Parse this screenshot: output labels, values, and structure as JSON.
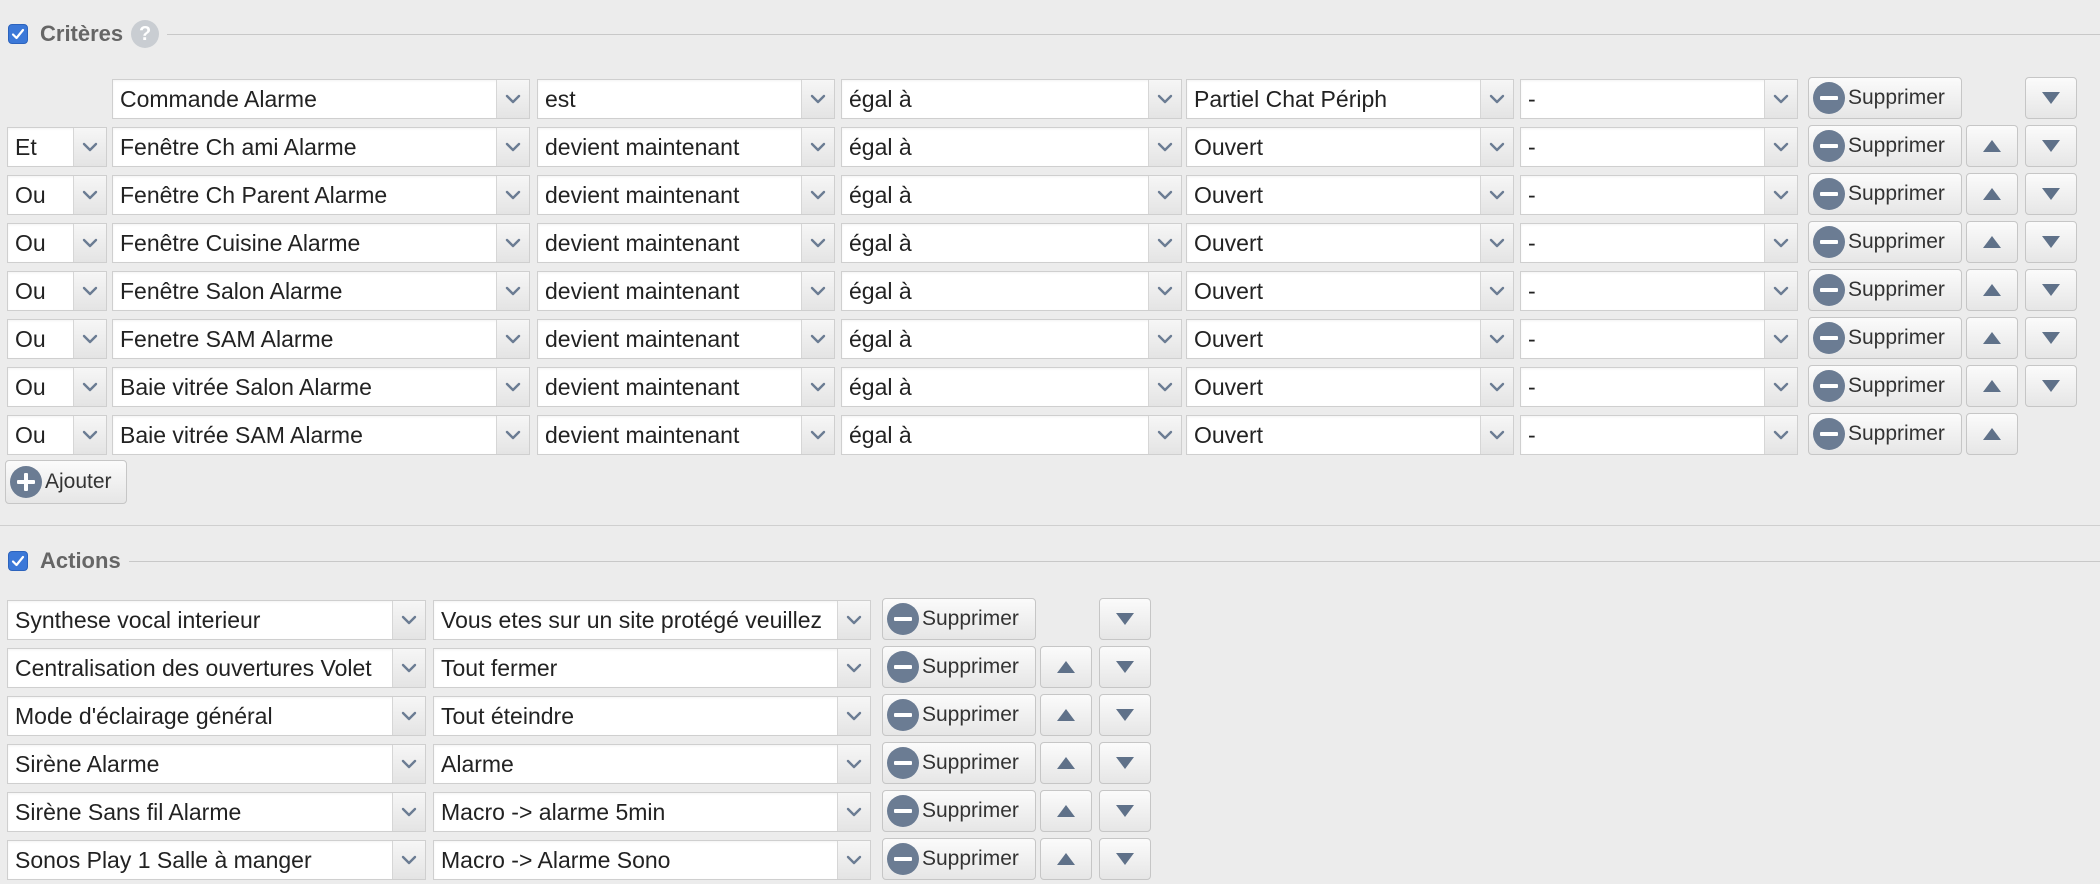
{
  "criteria": {
    "title": "Critères",
    "help_icon": "question-mark-icon",
    "help_text": "?",
    "delete_label": "Supprimer",
    "add_label": "Ajouter",
    "rows": [
      {
        "logic": "",
        "device": "Commande Alarme",
        "verb": "est",
        "operator": "égal à",
        "value": "Partiel Chat Périph",
        "extra": "-",
        "up": false,
        "down": true
      },
      {
        "logic": "Et",
        "device": "Fenêtre Ch ami Alarme",
        "verb": "devient maintenant",
        "operator": "égal à",
        "value": "Ouvert",
        "extra": "-",
        "up": true,
        "down": true
      },
      {
        "logic": "Ou",
        "device": "Fenêtre Ch Parent Alarme",
        "verb": "devient maintenant",
        "operator": "égal à",
        "value": "Ouvert",
        "extra": "-",
        "up": true,
        "down": true
      },
      {
        "logic": "Ou",
        "device": "Fenêtre Cuisine Alarme",
        "verb": "devient maintenant",
        "operator": "égal à",
        "value": "Ouvert",
        "extra": "-",
        "up": true,
        "down": true
      },
      {
        "logic": "Ou",
        "device": "Fenêtre Salon Alarme",
        "verb": "devient maintenant",
        "operator": "égal à",
        "value": "Ouvert",
        "extra": "-",
        "up": true,
        "down": true
      },
      {
        "logic": "Ou",
        "device": "Fenetre SAM Alarme",
        "verb": "devient maintenant",
        "operator": "égal à",
        "value": "Ouvert",
        "extra": "-",
        "up": true,
        "down": true
      },
      {
        "logic": "Ou",
        "device": "Baie vitrée Salon Alarme",
        "verb": "devient maintenant",
        "operator": "égal à",
        "value": "Ouvert",
        "extra": "-",
        "up": true,
        "down": true
      },
      {
        "logic": "Ou",
        "device": "Baie vitrée SAM Alarme",
        "verb": "devient maintenant",
        "operator": "égal à",
        "value": "Ouvert",
        "extra": "-",
        "up": true,
        "down": false
      }
    ]
  },
  "actions": {
    "title": "Actions",
    "delete_label": "Supprimer",
    "rows": [
      {
        "device": "Synthese vocal interieur",
        "command": "Vous etes sur un site protégé veuillez",
        "up": false,
        "down": true
      },
      {
        "device": "Centralisation des ouvertures Volet",
        "command": "Tout fermer",
        "up": true,
        "down": true
      },
      {
        "device": "Mode d'éclairage général",
        "command": "Tout éteindre",
        "up": true,
        "down": true
      },
      {
        "device": "Sirène Alarme",
        "command": "Alarme",
        "up": true,
        "down": true
      },
      {
        "device": "Sirène Sans fil Alarme",
        "command": "Macro -> alarme 5min",
        "up": true,
        "down": true
      },
      {
        "device": "Sonos Play 1 Salle à manger",
        "command": "Macro -> Alarme Sono",
        "up": true,
        "down": true
      }
    ]
  },
  "colors": {
    "checkbox": "#3b78d8",
    "icon_fill": "#6b7c93",
    "background": "#ececec"
  }
}
